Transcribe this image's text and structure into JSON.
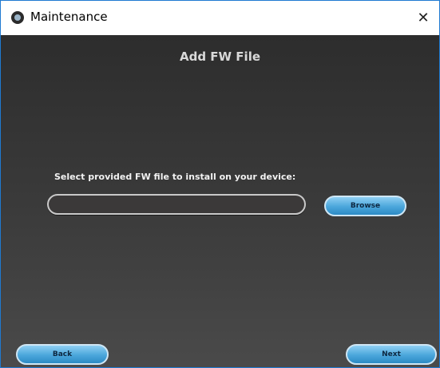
{
  "window": {
    "title": "Maintenance",
    "close_glyph": "✕",
    "app_icon": "app-logo-icon"
  },
  "main": {
    "heading": "Add FW File",
    "prompt": "Select provided FW file to install on your device:",
    "file_path_value": "",
    "browse_label": "Browse"
  },
  "footer": {
    "back_label": "Back",
    "next_label": "Next"
  },
  "colors": {
    "button_accent": "#4aa6db",
    "panel_background": "#3a3a3a",
    "window_border": "#1f7ad1"
  }
}
